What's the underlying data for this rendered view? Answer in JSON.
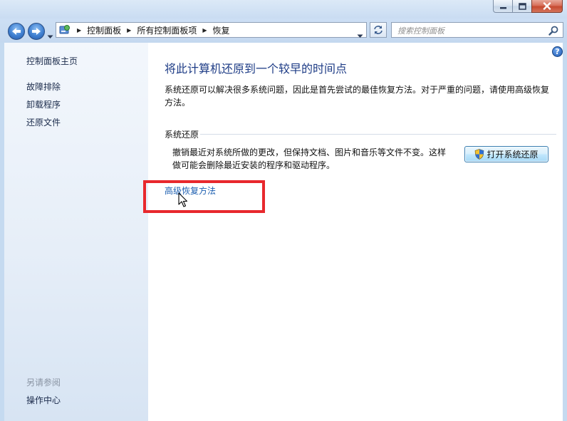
{
  "address_bar": {
    "crumbs": [
      "控制面板",
      "所有控制面板项",
      "恢复"
    ]
  },
  "search": {
    "placeholder": "搜索控制面板"
  },
  "sidebar": {
    "home_link": "控制面板主页",
    "items": [
      {
        "label": "故障排除"
      },
      {
        "label": "卸载程序"
      },
      {
        "label": "还原文件"
      }
    ],
    "see_also_label": "另请参阅",
    "see_also_items": [
      {
        "label": "操作中心"
      }
    ]
  },
  "main": {
    "help_glyph": "?",
    "title": "将此计算机还原到一个较早的时间点",
    "description": "系统还原可以解决很多系统问题，因此是首先尝试的最佳恢复方法。对于严重的问题，请使用高级恢复方法。",
    "section": {
      "title": "系统还原",
      "description": "撤销最近对系统所做的更改，但保持文档、图片和音乐等文件不变。这样做可能会删除最近安装的程序和驱动程序。",
      "button_label": "打开系统还原"
    },
    "advanced_link": "高级恢复方法"
  },
  "colors": {
    "title_blue": "#1e3c86",
    "link_blue": "#1d5fb0",
    "highlight_red": "#e8282d",
    "sidebar_bg": "#e6eef8",
    "frame_blue": "#c5daf0"
  },
  "icons": {
    "back": "back-arrow-icon",
    "forward": "forward-arrow-icon",
    "control_panel": "control-panel-icon",
    "refresh": "refresh-icon",
    "search": "search-icon",
    "help": "help-icon",
    "shield": "uac-shield-icon"
  }
}
